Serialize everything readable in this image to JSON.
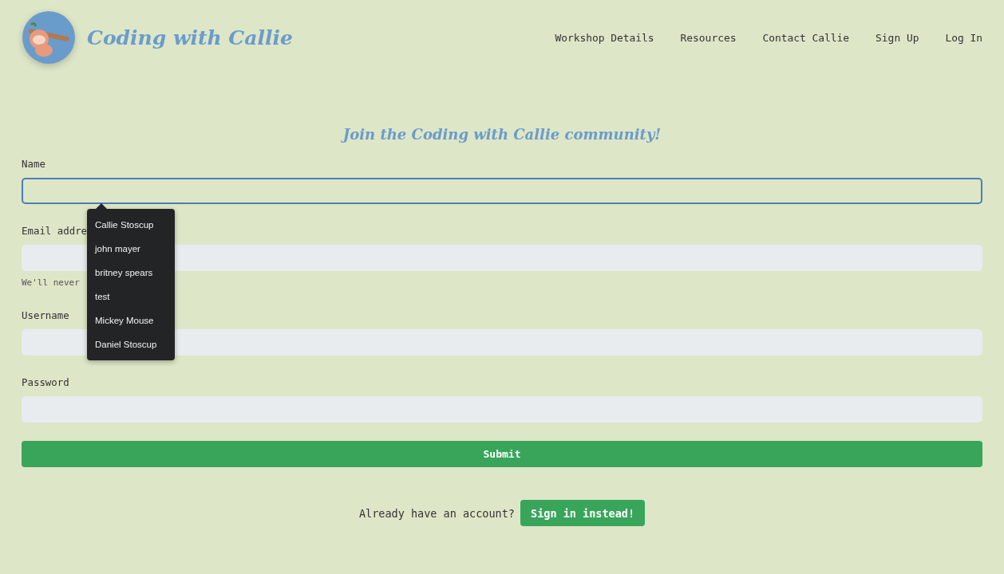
{
  "header": {
    "brand": "Coding with Callie",
    "nav": [
      {
        "label": "Workshop Details"
      },
      {
        "label": "Resources"
      },
      {
        "label": "Contact Callie"
      },
      {
        "label": "Sign Up"
      },
      {
        "label": "Log In"
      }
    ]
  },
  "heading": "Join the Coding with Callie community!",
  "fields": [
    {
      "label": "Name",
      "focused": true
    },
    {
      "label": "Email addre",
      "focused": false,
      "help": "We'll never"
    },
    {
      "label": "Username",
      "focused": false
    },
    {
      "label": "Password",
      "focused": false
    }
  ],
  "autocomplete": {
    "items": [
      "Callie Stoscup",
      "john mayer",
      "britney spears",
      "test",
      "Mickey Mouse",
      "Daniel Stoscup"
    ]
  },
  "submit": "Submit",
  "footer": {
    "prompt": "Already have an account?",
    "button": "Sign in instead!"
  }
}
